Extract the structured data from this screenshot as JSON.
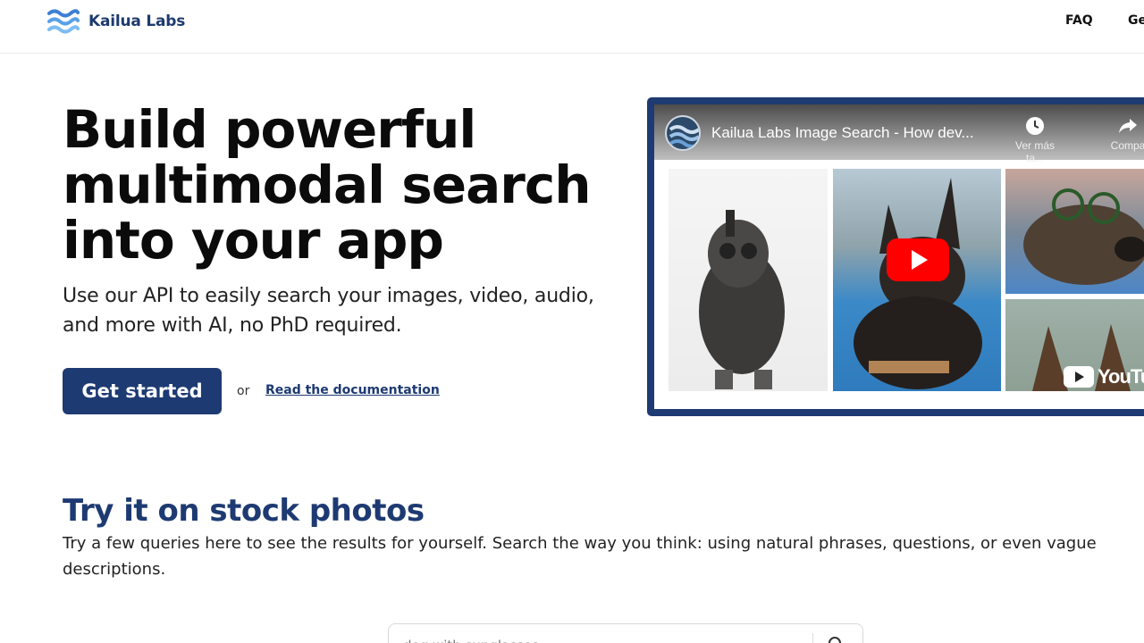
{
  "header": {
    "brand": "Kailua Labs",
    "nav": {
      "faq": "FAQ",
      "get": "Ge"
    }
  },
  "hero": {
    "title": "Build powerful multimodal search into your app",
    "subtitle": "Use our API to easily search your images, video, audio, and more with AI, no PhD required.",
    "cta_label": "Get started",
    "or_text": "or",
    "docs_link": "Read the documentation"
  },
  "video": {
    "title": "Kailua Labs Image Search - How dev...",
    "watch_later": "Ver más ta...",
    "share": "Compa",
    "yt_wordmark": "YouTu"
  },
  "stock_section": {
    "title": "Try it on stock photos",
    "description": "Try a few queries here to see the results for yourself. Search the way you think: using natural phrases, questions, or even vague descriptions.",
    "search_placeholder": "dog with sunglasses"
  },
  "colors": {
    "brand_navy": "#1e3a72",
    "youtube_red": "#ff0000"
  }
}
